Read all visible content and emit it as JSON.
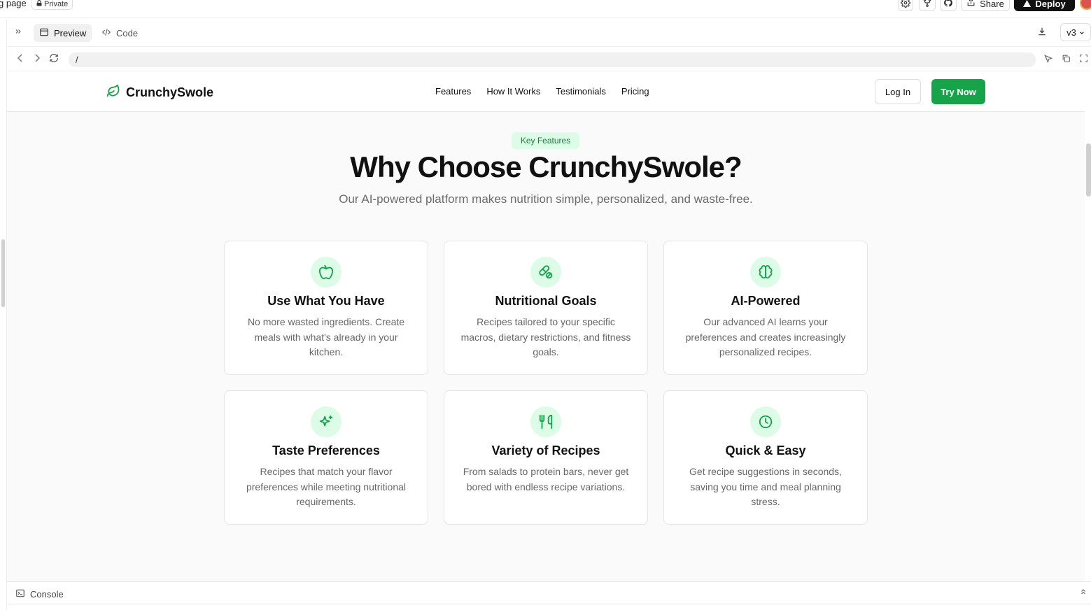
{
  "topbar": {
    "project_name": "g page",
    "visibility": "Private",
    "share_label": "Share",
    "deploy_label": "Deploy"
  },
  "tabs": {
    "preview_label": "Preview",
    "code_label": "Code",
    "version": "v3"
  },
  "url": {
    "path": "/"
  },
  "site": {
    "brand": "CrunchySwole",
    "nav": [
      "Features",
      "How It Works",
      "Testimonials",
      "Pricing"
    ],
    "login_label": "Log In",
    "try_label": "Try Now",
    "accent": "#16a34a"
  },
  "features": {
    "pill": "Key Features",
    "title": "Why Choose CrunchySwole?",
    "subtitle": "Our AI-powered platform makes nutrition simple, personalized, and waste-free.",
    "cards": [
      {
        "icon": "apple-icon",
        "title": "Use What You Have",
        "desc": "No more wasted ingredients. Create meals with what's already in your kitchen."
      },
      {
        "icon": "pill-icon",
        "title": "Nutritional Goals",
        "desc": "Recipes tailored to your specific macros, dietary restrictions, and fitness goals."
      },
      {
        "icon": "brain-icon",
        "title": "AI-Powered",
        "desc": "Our advanced AI learns your preferences and creates increasingly personalized recipes."
      },
      {
        "icon": "sparkles-icon",
        "title": "Taste Preferences",
        "desc": "Recipes that match your flavor preferences while meeting nutritional requirements."
      },
      {
        "icon": "utensils-icon",
        "title": "Variety of Recipes",
        "desc": "From salads to protein bars, never get bored with endless recipe variations."
      },
      {
        "icon": "clock-icon",
        "title": "Quick & Easy",
        "desc": "Get recipe suggestions in seconds, saving you time and meal planning stress."
      }
    ]
  },
  "console": {
    "label": "Console"
  }
}
